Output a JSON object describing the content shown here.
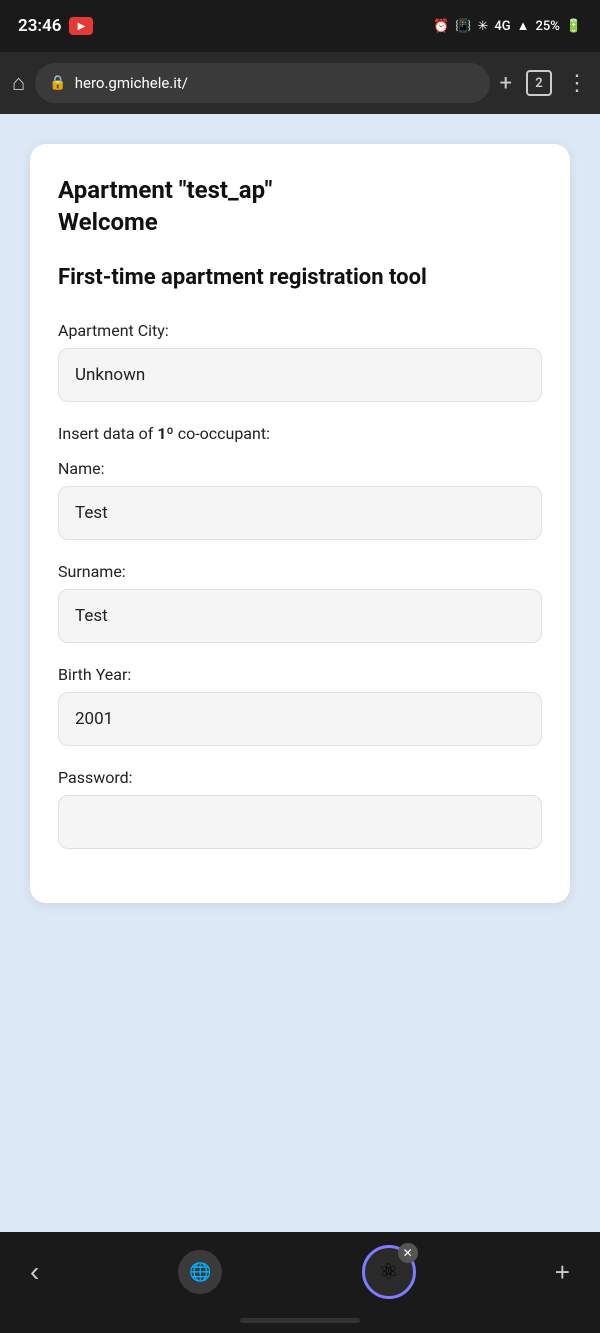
{
  "statusBar": {
    "time": "23:46",
    "battery": "25%"
  },
  "browserBar": {
    "url": "hero.gmichele.it/",
    "tabCount": "2"
  },
  "page": {
    "apartmentTitle": "Apartment \"test_ap\"",
    "welcome": "Welcome",
    "toolTitle": "First-time apartment registration tool",
    "apartmentCityLabel": "Apartment City:",
    "apartmentCityValue": "Unknown",
    "insertLabel1": "Insert data of ",
    "insertLabelBold": "1º",
    "insertLabel2": " co-occupant:",
    "nameLabel": "Name:",
    "nameValue": "Test",
    "surnameLabel": "Surname:",
    "surnameValue": "Test",
    "birthYearLabel": "Birth Year:",
    "birthYearValue": "2001",
    "passwordLabel": "Password:"
  },
  "bottomNav": {
    "backLabel": "‹",
    "plusLabel": "+"
  }
}
